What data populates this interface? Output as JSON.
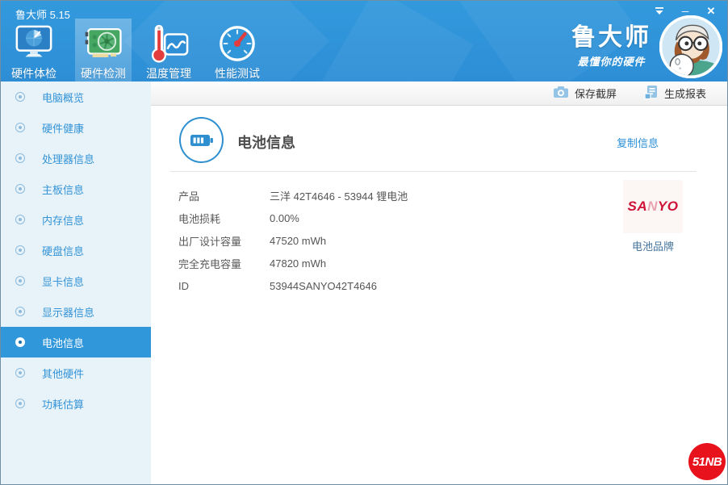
{
  "window": {
    "title": "鲁大师 5.15",
    "controls": {
      "minimize_glyph": "─",
      "close_glyph": "✕"
    }
  },
  "header": {
    "tabs": [
      {
        "label": "硬件体检",
        "icon": "monitor-scan-icon",
        "selected": false
      },
      {
        "label": "硬件检测",
        "icon": "gpu-card-icon",
        "selected": true
      },
      {
        "label": "温度管理",
        "icon": "thermometer-chart-icon",
        "selected": false
      },
      {
        "label": "性能测试",
        "icon": "gauge-icon",
        "selected": false
      }
    ],
    "brand": {
      "name": "鲁大师",
      "tagline": "最懂你的硬件"
    }
  },
  "sidebar": {
    "items": [
      {
        "label": "电脑概览",
        "selected": false
      },
      {
        "label": "硬件健康",
        "selected": false
      },
      {
        "label": "处理器信息",
        "selected": false
      },
      {
        "label": "主板信息",
        "selected": false
      },
      {
        "label": "内存信息",
        "selected": false
      },
      {
        "label": "硬盘信息",
        "selected": false
      },
      {
        "label": "显卡信息",
        "selected": false
      },
      {
        "label": "显示器信息",
        "selected": false
      },
      {
        "label": "电池信息",
        "selected": true
      },
      {
        "label": "其他硬件",
        "selected": false
      },
      {
        "label": "功耗估算",
        "selected": false
      }
    ]
  },
  "actionbar": {
    "save_screenshot": "保存截屏",
    "generate_report": "生成报表"
  },
  "main": {
    "title": "电池信息",
    "copy_link": "复制信息",
    "rows": [
      {
        "label": "产品",
        "value": "三洋 42T4646 - 53944 锂电池"
      },
      {
        "label": "电池损耗",
        "value": "0.00%"
      },
      {
        "label": "出厂设计容量",
        "value": "47520 mWh"
      },
      {
        "label": "完全充电容量",
        "value": "47820 mWh"
      },
      {
        "label": "ID",
        "value": "53944SANYO42T4646"
      }
    ],
    "brand_box": {
      "logo_sa": "SA",
      "logo_n": "N",
      "logo_yo": "YO",
      "caption": "电池品牌"
    },
    "watermark": "51NB"
  },
  "colors": {
    "header_blue": "#2e91d6",
    "sidebar_bg": "#e8f2f9",
    "sidebar_selected": "#3197db",
    "link_blue": "#2b8fd8",
    "sanyo_red": "#ce1238",
    "badge_red": "#e8121c"
  }
}
